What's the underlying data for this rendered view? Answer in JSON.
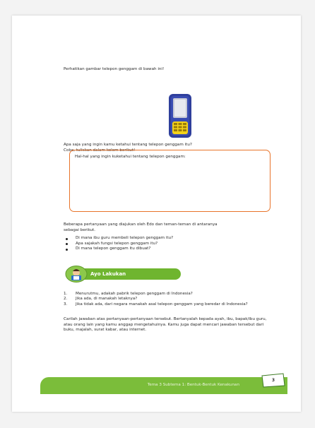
{
  "intro": "Perhatikan gambar telepon genggam di bawah ini!",
  "question": {
    "line1": "Apa saja yang ingin kamu ketahui tentang telepon genggam itu?",
    "line2": "Coba, tuliskan dalam kolom berikut!"
  },
  "answer_box": {
    "label": "Hal-hal yang ingin kuketahui tentang telepon genggam:"
  },
  "questions_intro": {
    "line1": "Beberapa pertanyaan yang diajukan oleh Edo dan teman-teman di antaranya",
    "line2": "sebagai berikut."
  },
  "bullets": [
    "Di mana ibu guru membeli telepon genggam itu?",
    "Apa sajakah fungsi telepon genggam itu?",
    "Di mana telepon genggam itu dibuat?"
  ],
  "ayo_lakukan": {
    "label": "Ayo Lakukan"
  },
  "numbered": [
    {
      "num": "1.",
      "text": "Menurutmu, adakah pabrik telepon genggam di Indonesia?"
    },
    {
      "num": "2.",
      "text": "Jika ada, di manakah letaknya?"
    },
    {
      "num": "3.",
      "text": "Jika tidak ada, dari negara manakah asal telepon genggam yang beredar di Indonesia?"
    }
  ],
  "paragraph": "Carilah jawaban atas pertanyaan-pertanyaan tersebut. Bertanyalah kepada ayah, ibu, bapak/ibu guru, atau orang lain yang kamu anggap mengetahuinya. Kamu juga dapat mencari jawaban tersebut dari buku, majalah, surat kabar, atau internet.",
  "footer": {
    "text": "Tema 3 Subtema 1: Bentuk-Bentuk Kenakunan",
    "page": "3"
  },
  "colors": {
    "accent_green": "#7bbd3a",
    "box_orange": "#e8742a",
    "phone_blue": "#2f3f9c",
    "keypad_yellow": "#f4d21a"
  },
  "icons": {
    "phone": "mobile-phone-illustration",
    "ayo": "boy-reading-icon"
  }
}
